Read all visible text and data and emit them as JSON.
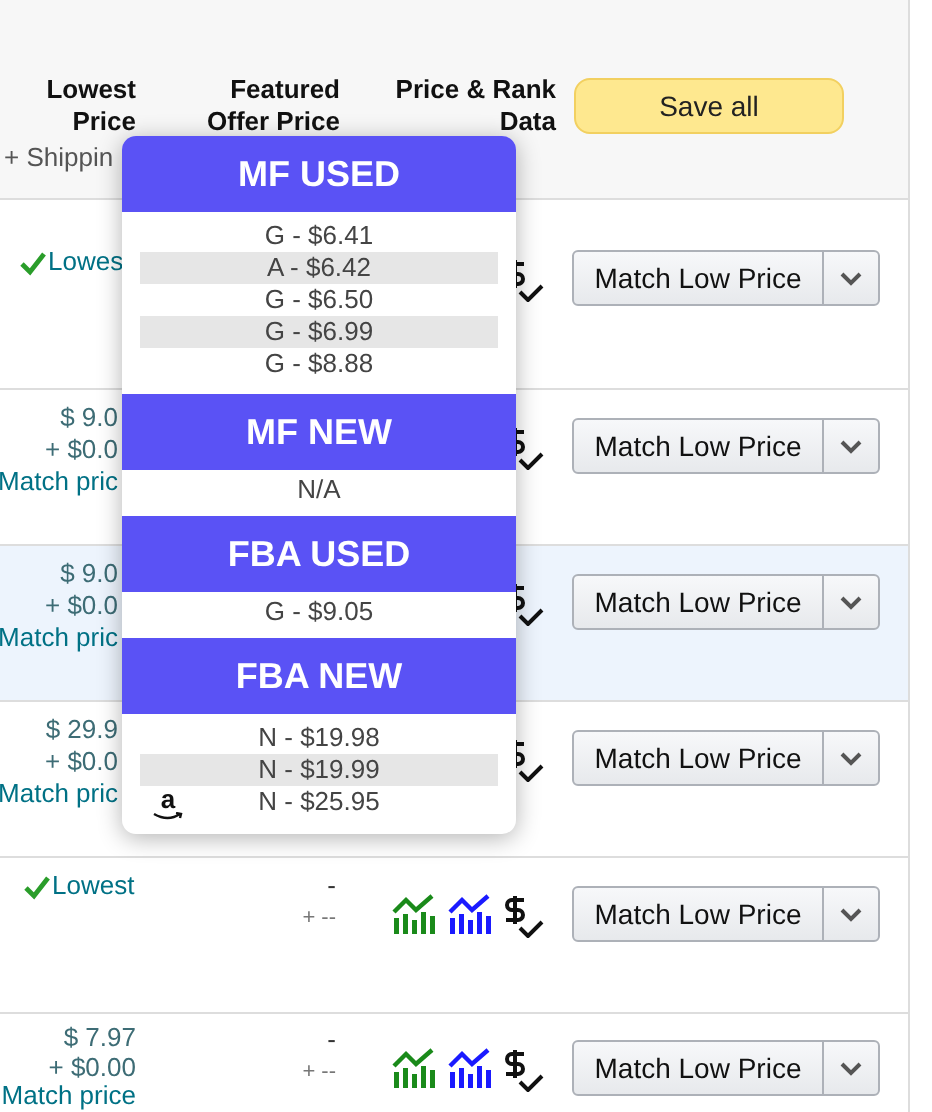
{
  "header": {
    "lowest_price": "Lowest Price",
    "shipping": "+ Shippin",
    "featured_offer_price": "Featured Offer Price",
    "price_rank_data": "Price & Rank Data",
    "save_button": "Save all"
  },
  "rows": [
    {
      "selected": false,
      "covered": true,
      "lowest": {
        "kind": "lowest",
        "label": "Lowes"
      },
      "button": "Match Low Price"
    },
    {
      "selected": false,
      "covered": true,
      "lowest": {
        "kind": "price",
        "price": "$ 9.0",
        "shipping": "+ $0.0",
        "link": "Match pric"
      },
      "button": "Match Low Price"
    },
    {
      "selected": true,
      "covered": true,
      "lowest": {
        "kind": "price",
        "price": "$ 9.0",
        "shipping": "+ $0.0",
        "link": "Match pric"
      },
      "button": "Match Low Price"
    },
    {
      "selected": false,
      "covered": true,
      "lowest": {
        "kind": "price",
        "price": "$ 29.9",
        "shipping": "+ $0.0",
        "link": "Match pric"
      },
      "button": "Match Low Price"
    },
    {
      "selected": false,
      "covered": false,
      "lowest": {
        "kind": "lowest",
        "label": "Lowest"
      },
      "featured": {
        "price": "-",
        "shipping": "+ --"
      },
      "button": "Match Low Price"
    },
    {
      "selected": false,
      "covered": false,
      "lowest": {
        "kind": "price",
        "price": "$ 7.97",
        "shipping": "+ $0.00",
        "link": "Match price"
      },
      "featured": {
        "price": "-",
        "shipping": "+ --"
      },
      "button": "Match Low Price"
    }
  ],
  "popup": {
    "sections": [
      {
        "title": "MF USED",
        "items": [
          {
            "text": "G - $6.41",
            "shaded": false
          },
          {
            "text": "A - $6.42",
            "shaded": true
          },
          {
            "text": "G - $6.50",
            "shaded": false
          },
          {
            "text": "G - $6.99",
            "shaded": true
          },
          {
            "text": "G - $8.88",
            "shaded": false
          }
        ]
      },
      {
        "title": "MF NEW",
        "items": [
          {
            "text": "N/A",
            "shaded": false
          }
        ]
      },
      {
        "title": "FBA USED",
        "items": [
          {
            "text": "G - $9.05",
            "shaded": false
          }
        ]
      },
      {
        "title": "FBA NEW",
        "items": [
          {
            "text": "N - $19.98",
            "shaded": false
          },
          {
            "text": "N - $19.99",
            "shaded": true
          },
          {
            "text": "N - $25.95",
            "shaded": false,
            "logo": "a"
          }
        ]
      }
    ]
  }
}
